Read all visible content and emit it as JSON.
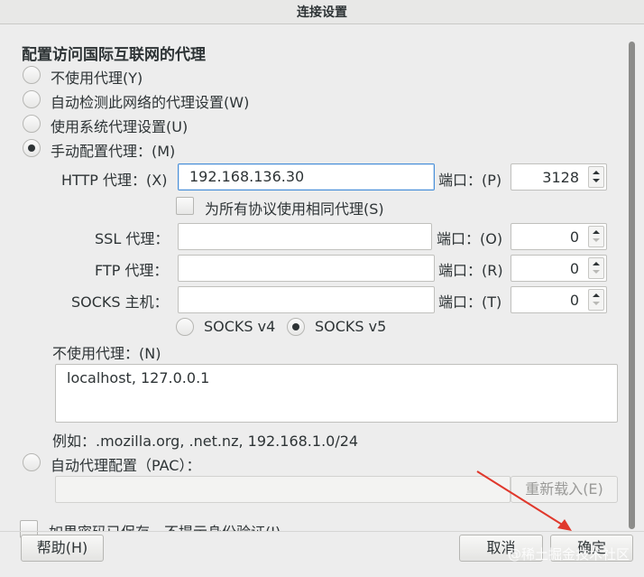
{
  "window": {
    "title": "连接设置"
  },
  "heading": "配置访问国际互联网的代理",
  "proxy_modes": [
    {
      "label": "不使用代理(Y)",
      "checked": false
    },
    {
      "label": "自动检测此网络的代理设置(W)",
      "checked": false
    },
    {
      "label": "使用系统代理设置(U)",
      "checked": false
    },
    {
      "label": "手动配置代理：(M)",
      "checked": true
    }
  ],
  "http": {
    "label": "HTTP 代理：(X)",
    "value": "192.168.136.30",
    "port_label": "端口：(P)",
    "port": "3128"
  },
  "same_proxy": {
    "label": "为所有协议使用相同代理(S)",
    "checked": false
  },
  "ssl": {
    "label": "SSL 代理：",
    "value": "",
    "port_label": "端口：(O)",
    "port": "0"
  },
  "ftp": {
    "label": "FTP 代理：",
    "value": "",
    "port_label": "端口：(R)",
    "port": "0"
  },
  "socks": {
    "label": "SOCKS 主机：",
    "value": "",
    "port_label": "端口：(T)",
    "port": "0"
  },
  "socks_versions": [
    {
      "label": "SOCKS v4",
      "checked": false
    },
    {
      "label": "SOCKS v5",
      "checked": true
    }
  ],
  "no_proxy": {
    "label": "不使用代理：(N)",
    "value": "localhost, 127.0.0.1",
    "example": "例如：.mozilla.org, .net.nz, 192.168.1.0/24"
  },
  "pac": {
    "label": "自动代理配置（PAC）：",
    "value": "",
    "reload_label": "重新载入(E)",
    "checked": false
  },
  "auth": {
    "label": "如果密码已保存，不提示身份验证(I)",
    "checked": false
  },
  "footer": {
    "help_label": "帮助(H)",
    "cancel_label": "取消",
    "ok_label": "确定"
  },
  "watermark": "@稀土掘金技术社区",
  "colors": {
    "accent": "#4a90d9",
    "annotation_arrow": "#e0382c",
    "background": "#ededed"
  }
}
